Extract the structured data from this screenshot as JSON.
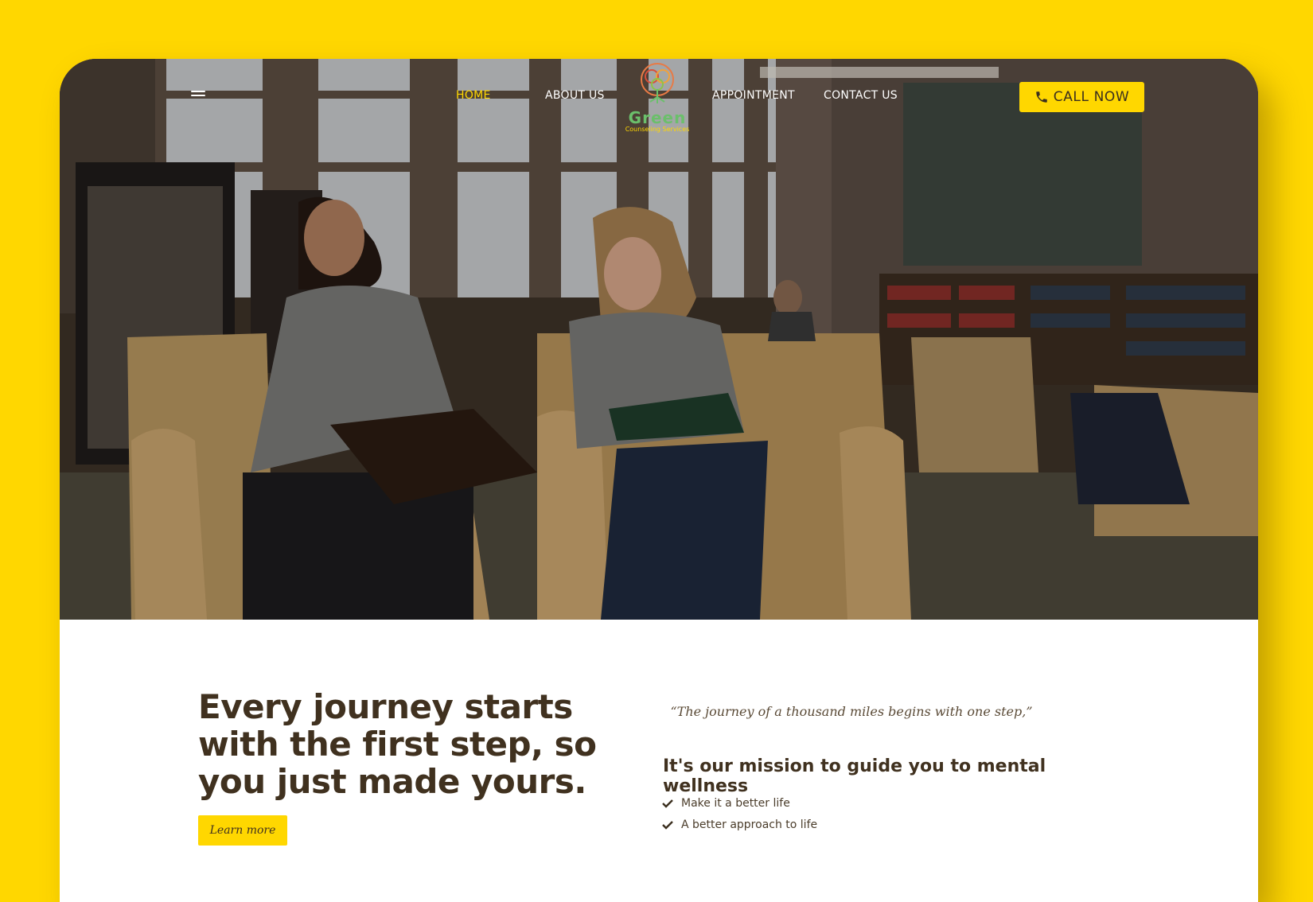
{
  "nav": {
    "menu_icon": "hamburger-icon",
    "links": [
      {
        "label": "HOME",
        "active": true
      },
      {
        "label": "ABOUT US",
        "active": false
      },
      {
        "label": "APPOINTMENT",
        "active": false
      },
      {
        "label": "CONTACT US",
        "active": false
      }
    ],
    "logo": {
      "word": "Green",
      "subtitle": "Counseling Services"
    },
    "call_button": {
      "label": "CALL NOW",
      "icon": "phone-icon"
    }
  },
  "hero": {
    "image": "Two students talking in a library lounge"
  },
  "intro": {
    "headline": "Every journey starts with the first step, so you just made yours.",
    "cta_label": "Learn more",
    "quote": "“The journey of a thousand miles begins with one step,”",
    "mission": "It's our mission to guide you to mental wellness",
    "bullets": [
      "Make it a better life",
      "A better approach to life"
    ]
  },
  "colors": {
    "accent": "#FFD700",
    "text_dark": "#40311f",
    "background": "#FFFFFF"
  }
}
